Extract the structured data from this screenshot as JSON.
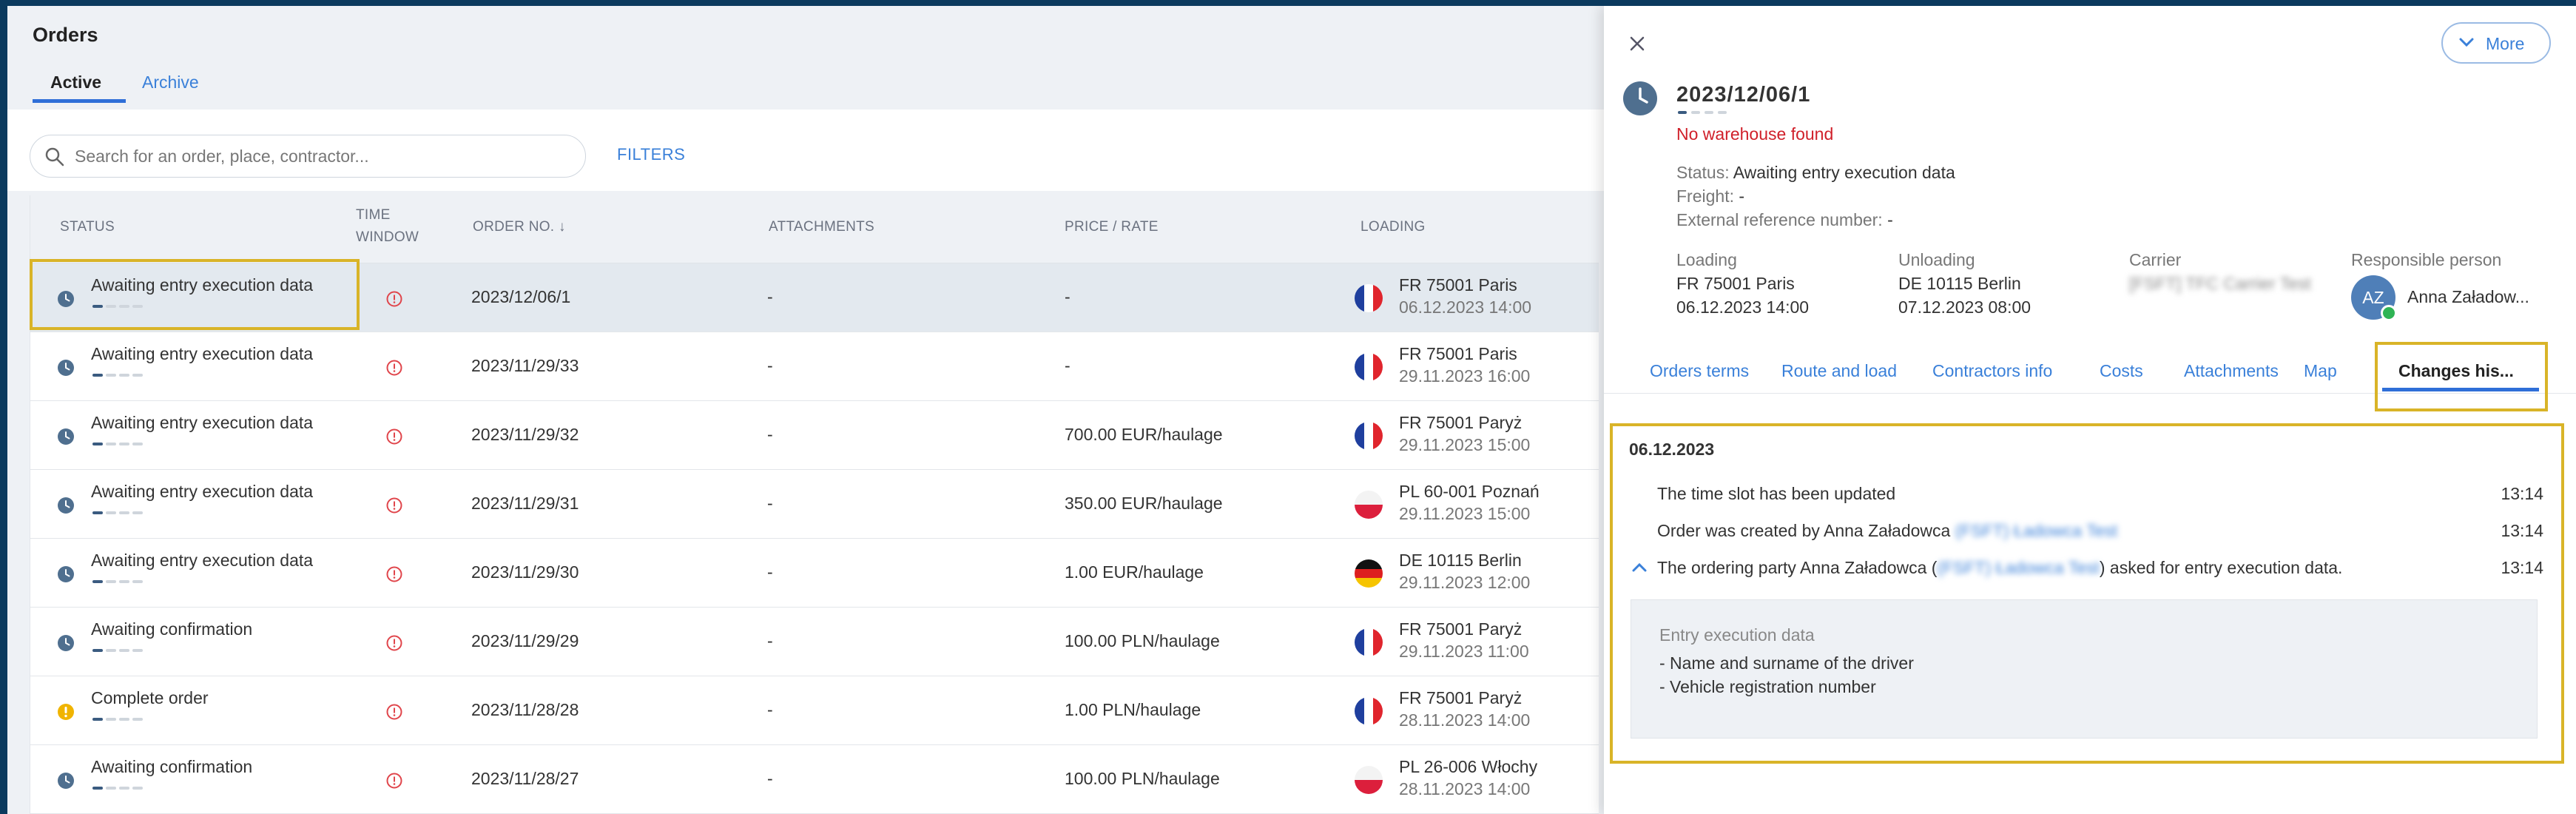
{
  "header": {
    "title": "Orders",
    "tabs": [
      {
        "label": "Active"
      },
      {
        "label": "Archive"
      }
    ]
  },
  "search": {
    "placeholder": "Search for an order, place, contractor...",
    "value": ""
  },
  "filters_label": "FILTERS",
  "table": {
    "columns": {
      "status": "STATUS",
      "time_window_1": "TIME",
      "time_window_2": "WINDOW",
      "order_no": "ORDER NO.",
      "attachments": "ATTACHMENTS",
      "price": "PRICE / RATE",
      "loading": "LOADING"
    },
    "rows": [
      {
        "status": "Awaiting entry execution data",
        "status_kind": "clock",
        "order_no": "2023/12/06/1",
        "attachments": "-",
        "price": "-",
        "flag": "FR",
        "place": "FR 75001 Paris",
        "date": "06.12.2023 14:00"
      },
      {
        "status": "Awaiting entry execution data",
        "status_kind": "clock",
        "order_no": "2023/11/29/33",
        "attachments": "-",
        "price": "-",
        "flag": "FR",
        "place": "FR 75001 Paris",
        "date": "29.11.2023 16:00"
      },
      {
        "status": "Awaiting entry execution data",
        "status_kind": "clock",
        "order_no": "2023/11/29/32",
        "attachments": "-",
        "price": "700.00 EUR/haulage",
        "flag": "FR",
        "place": "FR 75001 Paryż",
        "date": "29.11.2023 15:00"
      },
      {
        "status": "Awaiting entry execution data",
        "status_kind": "clock",
        "order_no": "2023/11/29/31",
        "attachments": "-",
        "price": "350.00 EUR/haulage",
        "flag": "PL",
        "place": "PL 60-001 Poznań",
        "date": "29.11.2023 15:00"
      },
      {
        "status": "Awaiting entry execution data",
        "status_kind": "clock",
        "order_no": "2023/11/29/30",
        "attachments": "-",
        "price": "1.00 EUR/haulage",
        "flag": "DE",
        "place": "DE 10115 Berlin",
        "date": "29.11.2023 12:00"
      },
      {
        "status": "Awaiting confirmation",
        "status_kind": "clock",
        "order_no": "2023/11/29/29",
        "attachments": "-",
        "price": "100.00 PLN/haulage",
        "flag": "FR",
        "place": "FR 75001 Paryż",
        "date": "29.11.2023 11:00"
      },
      {
        "status": "Complete order",
        "status_kind": "warning",
        "order_no": "2023/11/28/28",
        "attachments": "-",
        "price": "1.00 PLN/haulage",
        "flag": "FR",
        "place": "FR 75001 Paryż",
        "date": "28.11.2023 14:00"
      },
      {
        "status": "Awaiting confirmation",
        "status_kind": "clock",
        "order_no": "2023/11/28/27",
        "attachments": "-",
        "price": "100.00 PLN/haulage",
        "flag": "PL",
        "place": "PL 26-006 Włochy",
        "date": "28.11.2023 14:00"
      }
    ]
  },
  "panel": {
    "more_label": "More",
    "order_no": "2023/12/06/1",
    "warning": "No warehouse found",
    "status_key": "Status:",
    "status_value": "Awaiting entry execution data",
    "freight_key": "Freight:",
    "freight_value": "-",
    "extref_key": "External reference number:",
    "extref_value": "-",
    "loading_h": "Loading",
    "loading_place": "FR 75001 Paris",
    "loading_date": "06.12.2023 14:00",
    "unloading_h": "Unloading",
    "unloading_place": "DE 10115 Berlin",
    "unloading_date": "07.12.2023 08:00",
    "carrier_h": "Carrier",
    "carrier_value": "[FSFT] TFC Carrier Test",
    "resp_h": "Responsible person",
    "avatar_initials": "AZ",
    "resp_name": "Anna Załadow...",
    "tabs": [
      "Orders terms",
      "Route and load",
      "Contractors info",
      "Costs",
      "Attachments",
      "Map",
      "Changes his..."
    ],
    "history": {
      "date": "06.12.2023",
      "entries": [
        {
          "text": "The time slot has been updated",
          "time": "13:14"
        },
        {
          "text": "Order was created by Anna Załadowca",
          "link": "(FSFT) Ładowca Test",
          "time": "13:14"
        },
        {
          "text": "The ordering party Anna Załadowca (",
          "link": "(FSFT) Ładowca Test",
          "tail": ") asked for entry execution data.",
          "time": "13:14"
        }
      ],
      "detail_title": "Entry execution data",
      "detail_lines": [
        "- Name and surname of the driver",
        "- Vehicle registration number"
      ]
    }
  },
  "colors": {
    "accent": "#3a80d9",
    "highlight": "#d9b428",
    "error": "#d0202a",
    "status_clock": "#4f6f8f",
    "status_warning": "#f0b400"
  }
}
